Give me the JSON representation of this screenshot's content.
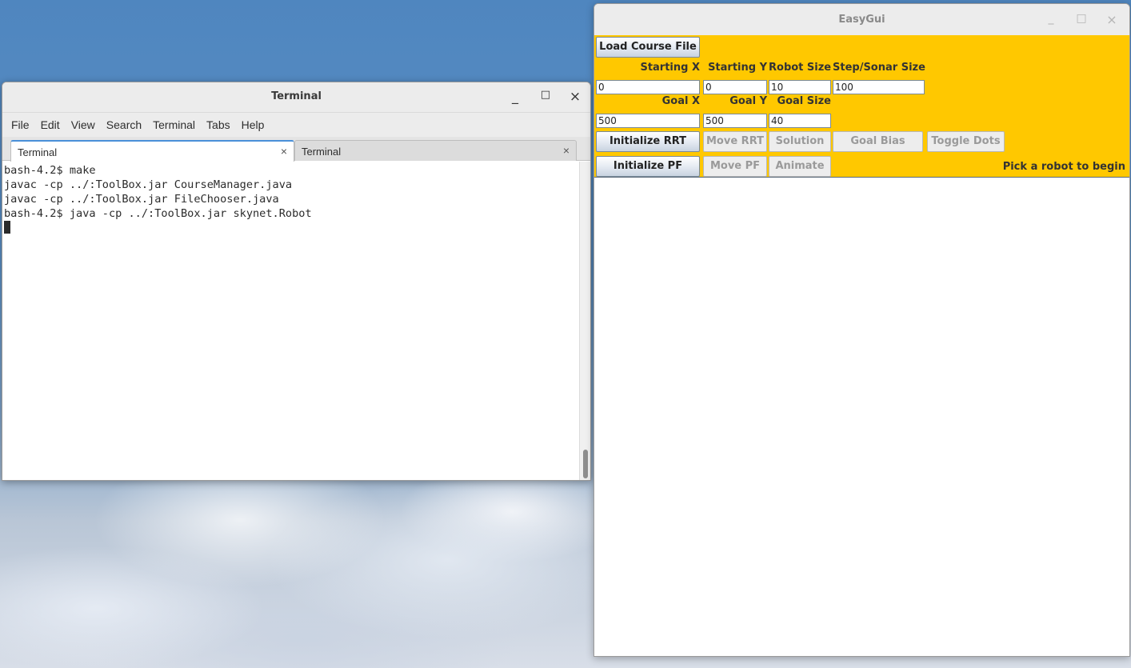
{
  "terminal": {
    "title": "Terminal",
    "controls": {
      "minimize": "_",
      "maximize": "□",
      "close": "×"
    },
    "menu": [
      "File",
      "Edit",
      "View",
      "Search",
      "Terminal",
      "Tabs",
      "Help"
    ],
    "tabs": [
      {
        "label": "Terminal",
        "close": "×",
        "active": true
      },
      {
        "label": "Terminal",
        "close": "×",
        "active": false
      }
    ],
    "lines": [
      "bash-4.2$ make",
      "javac -cp ../:ToolBox.jar CourseManager.java",
      "javac -cp ../:ToolBox.jar FileChooser.java",
      "bash-4.2$ java -cp ../:ToolBox.jar skynet.Robot"
    ]
  },
  "easygui": {
    "title": "EasyGui",
    "controls": {
      "minimize": "_",
      "maximize": "□",
      "close": "×"
    },
    "panel_color": "#ffc800",
    "load_button": "Load Course File",
    "labels": {
      "starting_x": "Starting X",
      "starting_y": "Starting Y",
      "robot_size": "Robot Size",
      "step_sonar_size": "Step/Sonar Size",
      "goal_x": "Goal X",
      "goal_y": "Goal Y",
      "goal_size": "Goal Size"
    },
    "fields": {
      "starting_x": "0",
      "starting_y": "0",
      "robot_size": "10",
      "step_sonar_size": "100",
      "goal_x": "500",
      "goal_y": "500",
      "goal_size": "40"
    },
    "buttons": {
      "initialize_rrt": "Initialize RRT",
      "move_rrt": "Move RRT",
      "solution": "Solution",
      "goal_bias": "Goal Bias",
      "toggle_dots": "Toggle Dots",
      "initialize_pf": "Initialize PF",
      "move_pf": "Move PF",
      "animate": "Animate"
    },
    "status": "Pick a robot to begin"
  }
}
